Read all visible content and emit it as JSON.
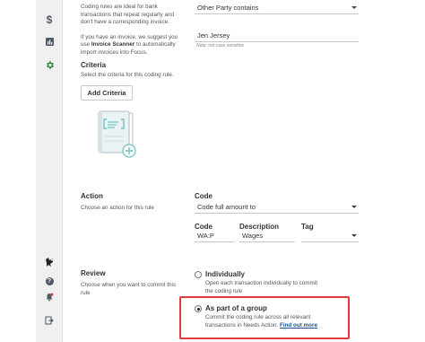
{
  "sidebar": {
    "items": [
      {
        "icon": "dollar-icon",
        "glyph": "$"
      },
      {
        "icon": "reports-icon"
      },
      {
        "icon": "settings-gear-icon"
      },
      {
        "icon": "mascot-icon"
      },
      {
        "icon": "help-icon",
        "glyph": "?"
      },
      {
        "icon": "notifications-bell-icon"
      },
      {
        "icon": "logout-icon"
      }
    ],
    "gear_color": "#2e8b3a"
  },
  "intro": {
    "line1": "Coding rules are ideal for bank",
    "line2": "transactions that repeat regularly and",
    "line3": "don't have a corresponding invoice.",
    "line4": "If you have an invoice, we suggest you",
    "line5_pre": "use ",
    "line5_bold": "Invoice Scanner",
    "line5_post": " to automatically",
    "line6": "import invoices into Focus."
  },
  "condition": {
    "select_value": "Other Party contains",
    "input_value": "Jen Jersey",
    "hint": "Note: not case sensitive"
  },
  "criteria": {
    "title": "Criteria",
    "description": "Select the criteria for this coding rule.",
    "add_button": "Add Criteria"
  },
  "action": {
    "title": "Action",
    "description": "Choose an action for this rule",
    "code_label": "Code",
    "code_select": "Code full amount to",
    "col_code": "Code",
    "col_description": "Description",
    "col_tag": "Tag",
    "code_value": "WA:P",
    "description_value": "Wages",
    "tag_value": ""
  },
  "review": {
    "title": "Review",
    "description_line1": "Choose when you want to commit this",
    "description_line2": "rule",
    "option1_title": "Individually",
    "option1_line1": "Open each transaction individually to commit",
    "option1_line2": "the coding rule",
    "option2_title": "As part of a group",
    "option2_line1": "Commit the coding rule across all relevant",
    "option2_line2_pre": "transactions in Needs Action. ",
    "option2_link": "Find out more",
    "selected": "As part of a group"
  },
  "colors": {
    "highlight": "#e03a3a",
    "link": "#1d4e8f",
    "illustration_accent": "#6cc3c1"
  }
}
